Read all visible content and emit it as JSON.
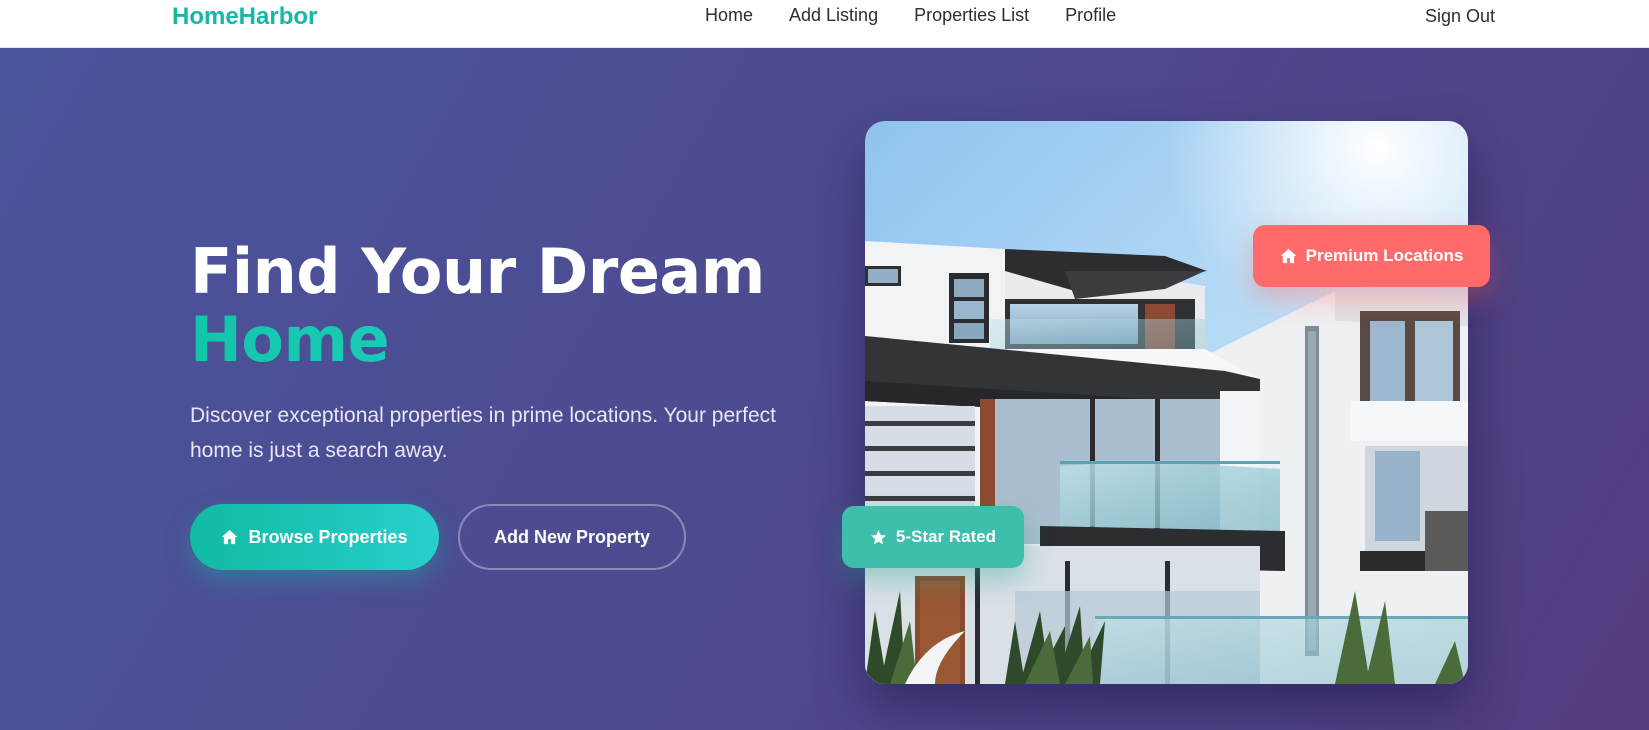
{
  "navbar": {
    "brand": "HomeHarbor",
    "links": [
      {
        "label": "Home"
      },
      {
        "label": "Add Listing"
      },
      {
        "label": "Properties List"
      },
      {
        "label": "Profile"
      }
    ],
    "sign_out": "Sign Out"
  },
  "hero": {
    "title_line1": "Find Your Dream",
    "title_line2": "Home",
    "description": "Discover exceptional properties in prime locations. Your perfect home is just a search away.",
    "primary_button": {
      "label": "Browse Properties",
      "icon": "home-icon"
    },
    "secondary_button": {
      "label": "Add New Property"
    }
  },
  "image_card": {
    "subject": "modern white multi-story house",
    "badges": {
      "premium": {
        "label": "Premium Locations",
        "icon": "home-icon",
        "color": "#ff6b6b"
      },
      "rated": {
        "label": "5-Star Rated",
        "icon": "star-icon",
        "color": "#3dbfab"
      }
    }
  },
  "colors": {
    "brand": "#14b8a6",
    "hero_gradient_start": "#4a549c",
    "hero_gradient_end": "#523c80",
    "accent": "#27d0cc"
  }
}
